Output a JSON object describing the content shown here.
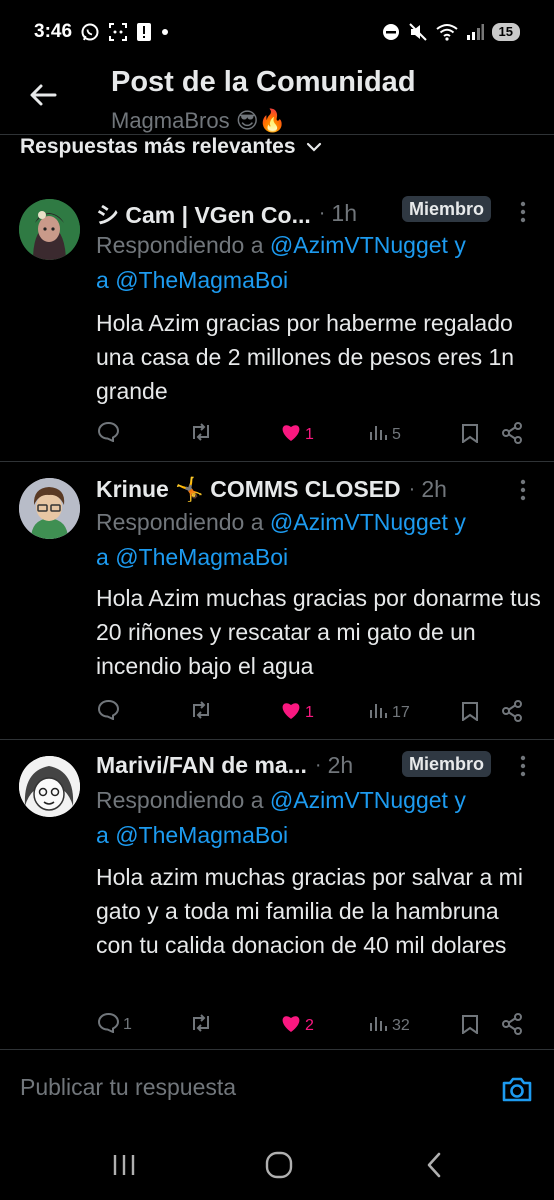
{
  "status_bar": {
    "time": "3:46",
    "battery_level": "15",
    "icons": [
      "whatsapp-icon",
      "scan-icon",
      "alert-icon",
      "dot-icon",
      "dnd-icon",
      "mute-icon",
      "wifi-icon",
      "signal-icon",
      "battery-icon"
    ]
  },
  "header": {
    "title": "Post de la Comunidad",
    "subtitle": "MagmaBros 😎🔥",
    "back_icon": "back-arrow-icon"
  },
  "sort": {
    "label": "Respuestas más relevantes",
    "icon": "chevron-down-icon"
  },
  "replies": [
    {
      "author": "シ Cam | VGen Co...",
      "time": "1h",
      "badge": "Miembro",
      "replying_prefix": "Respondiendo a",
      "mention_1": "@AzimVTNugget",
      "joiner_1": "y",
      "joiner_2": "a",
      "mention_2": "@TheMagmaBoi",
      "text": "Hola Azim gracias por haberme regalado una casa de 2 millones de pesos eres 1n grande",
      "reply_count": "",
      "repost_count": "",
      "like_count": "1",
      "view_count": "5",
      "liked": true
    },
    {
      "author": "Krinue 🤸 COMMS CLOSED",
      "time": "2h",
      "badge": "",
      "replying_prefix": "Respondiendo a",
      "mention_1": "@AzimVTNugget",
      "joiner_1": "y",
      "joiner_2": "a",
      "mention_2": "@TheMagmaBoi",
      "text": "Hola Azim muchas gracias por donarme tus 20 riñones y rescatar a mi gato de un incendio bajo el agua",
      "reply_count": "",
      "repost_count": "",
      "like_count": "1",
      "view_count": "17",
      "liked": true
    },
    {
      "author": "Marivi/FAN de ma...",
      "time": "2h",
      "badge": "Miembro",
      "replying_prefix": "Respondiendo a",
      "mention_1": "@AzimVTNugget",
      "joiner_1": "y",
      "joiner_2": "a",
      "mention_2": "@TheMagmaBoi",
      "text": "Hola azim muchas gracias por salvar a mi gato y a toda mi familia de la hambruna con tu calida donacion de 40 mil dolares",
      "reply_count": "1",
      "repost_count": "",
      "like_count": "2",
      "view_count": "32",
      "liked": true
    }
  ],
  "composer": {
    "placeholder": "Publicar tu respuesta",
    "icon": "camera-icon"
  },
  "navbar": {
    "icons": [
      "recents-icon",
      "home-icon",
      "back-icon"
    ]
  },
  "colors": {
    "background": "#000000",
    "text": "#e7e9ea",
    "muted": "#71767b",
    "accent": "#1d9bf0",
    "like": "#f91880",
    "badge_bg": "#2f3842",
    "divider": "#2f3336"
  }
}
